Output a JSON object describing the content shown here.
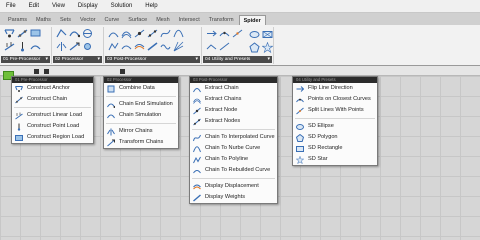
{
  "menubar": {
    "items": [
      "File",
      "Edit",
      "View",
      "Display",
      "Solution",
      "Help"
    ]
  },
  "tabs": [
    "Params",
    "Maths",
    "Sets",
    "Vector",
    "Curve",
    "Surface",
    "Mesh",
    "Intersect",
    "Transform",
    "Spider"
  ],
  "active_tab": "Spider",
  "ribbon": {
    "panels": [
      {
        "label": "01 Pre-Processor"
      },
      {
        "label": "02 Processor"
      },
      {
        "label": "03 Post-Processor"
      },
      {
        "label": "04 Utility and Presets"
      }
    ]
  },
  "dropdowns": {
    "pre_processor": {
      "header": "01 Pre-Processor",
      "items": [
        {
          "label": "Construct Anchor",
          "icon": "anchor-icon"
        },
        {
          "label": "Construct Chain",
          "icon": "chain-icon"
        },
        {
          "label": "Construct Linear Load",
          "icon": "linear-load-icon"
        },
        {
          "label": "Construct Point Load",
          "icon": "point-load-icon"
        },
        {
          "label": "Construct Region Load",
          "icon": "region-load-icon"
        }
      ]
    },
    "processor": {
      "header": "02 Processor",
      "items": [
        {
          "label": "Combine Data",
          "icon": "combine-data-icon"
        },
        {
          "label": "Chain End Simulation",
          "icon": "chain-end-simulation-icon"
        },
        {
          "label": "Chain Simulation",
          "icon": "chain-simulation-icon"
        },
        {
          "label": "Mirror Chains",
          "icon": "mirror-chains-icon"
        },
        {
          "label": "Transform Chains",
          "icon": "transform-chains-icon"
        }
      ]
    },
    "post_processor": {
      "header": "03 Post-Processor",
      "items": [
        {
          "label": "Extract Chain",
          "icon": "extract-chain-icon"
        },
        {
          "label": "Extract Chains",
          "icon": "extract-chains-icon"
        },
        {
          "label": "Extract Node",
          "icon": "extract-node-icon"
        },
        {
          "label": "Extract Nodes",
          "icon": "extract-nodes-icon"
        },
        {
          "label": "Chain To Interpolated Curve",
          "icon": "interpolated-curve-icon"
        },
        {
          "label": "Chain To Nurbe Curve",
          "icon": "nurbs-curve-icon"
        },
        {
          "label": "Chain To Polyline",
          "icon": "polyline-icon"
        },
        {
          "label": "Chain To Rebuilded Curve",
          "icon": "rebuilt-curve-icon"
        },
        {
          "label": "Display Displacement",
          "icon": "display-displacement-icon"
        },
        {
          "label": "Display Weights",
          "icon": "display-weights-icon"
        }
      ]
    },
    "utility": {
      "header": "04 Utility and Presets",
      "items": [
        {
          "label": "Flip Line Direction",
          "icon": "flip-line-icon"
        },
        {
          "label": "Points on Closest Curves",
          "icon": "points-closest-curves-icon"
        },
        {
          "label": "Split Lines With Points",
          "icon": "split-lines-icon"
        },
        {
          "label": "SD Ellipse",
          "icon": "ellipse-icon"
        },
        {
          "label": "SD Polygon",
          "icon": "polygon-icon"
        },
        {
          "label": "SD Rectangle",
          "icon": "rectangle-icon"
        },
        {
          "label": "SD Star",
          "icon": "star-icon"
        }
      ]
    }
  },
  "colors": {
    "accent_blue": "#3a6fb5",
    "header_dark": "#2b2b2b",
    "panel_label_bg": "#4a4a4a",
    "folder_green": "#6fbf3a"
  }
}
